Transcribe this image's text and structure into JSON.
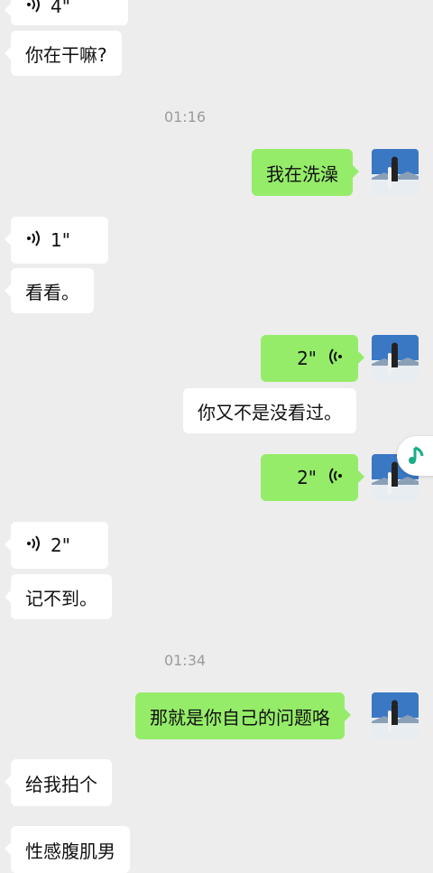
{
  "messages": {
    "m0_voice_in": "4\"",
    "m1_text_in": "你在干嘛?",
    "t1": "01:16",
    "m2_text_out": "我在洗澡",
    "m3_voice_in": "1\"",
    "m4_text_in": "看看。",
    "m5_voice_out": "2\"",
    "m6_text_in": "你又不是没看过。",
    "m7_voice_out": "2\"",
    "m8_voice_in": "2\"",
    "m9_text_in": "记不到。",
    "t2": "01:34",
    "m10_text_out": "那就是你自己的问题咯",
    "m11_text_in": "给我拍个",
    "m12_text_in": "性感腹肌男"
  },
  "colors": {
    "background": "#ededed",
    "incoming_bubble": "#ffffff",
    "outgoing_bubble": "#95ec69",
    "music_accent": "#1aad8a"
  },
  "icons": {
    "voice_incoming": "voice-wave-icon",
    "voice_outgoing": "voice-wave-icon",
    "floating_music": "music-note-icon",
    "avatar": "avatar-snow-mountain-photo"
  }
}
